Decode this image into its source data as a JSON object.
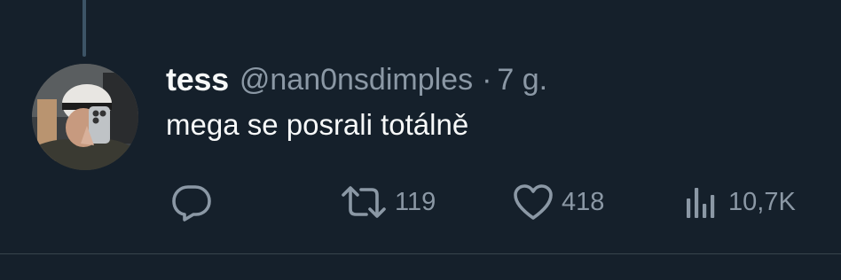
{
  "tweet": {
    "author": {
      "display_name": "tess",
      "handle": "@nan0nsdimples",
      "avatar_icon": "profile-photo"
    },
    "separator": "·",
    "time": "7 g.",
    "text": "mega se posrali totálně",
    "actions": {
      "reply": {
        "icon": "reply-icon",
        "count": ""
      },
      "retweet": {
        "icon": "retweet-icon",
        "count": "119"
      },
      "like": {
        "icon": "heart-icon",
        "count": "418"
      },
      "views": {
        "icon": "views-icon",
        "count": "10,7K"
      }
    }
  },
  "colors": {
    "background": "#15202b",
    "primary_text": "#f7f9f9",
    "secondary_text": "#8b98a5",
    "thread_line": "#3d5466",
    "divider": "#38444d"
  }
}
